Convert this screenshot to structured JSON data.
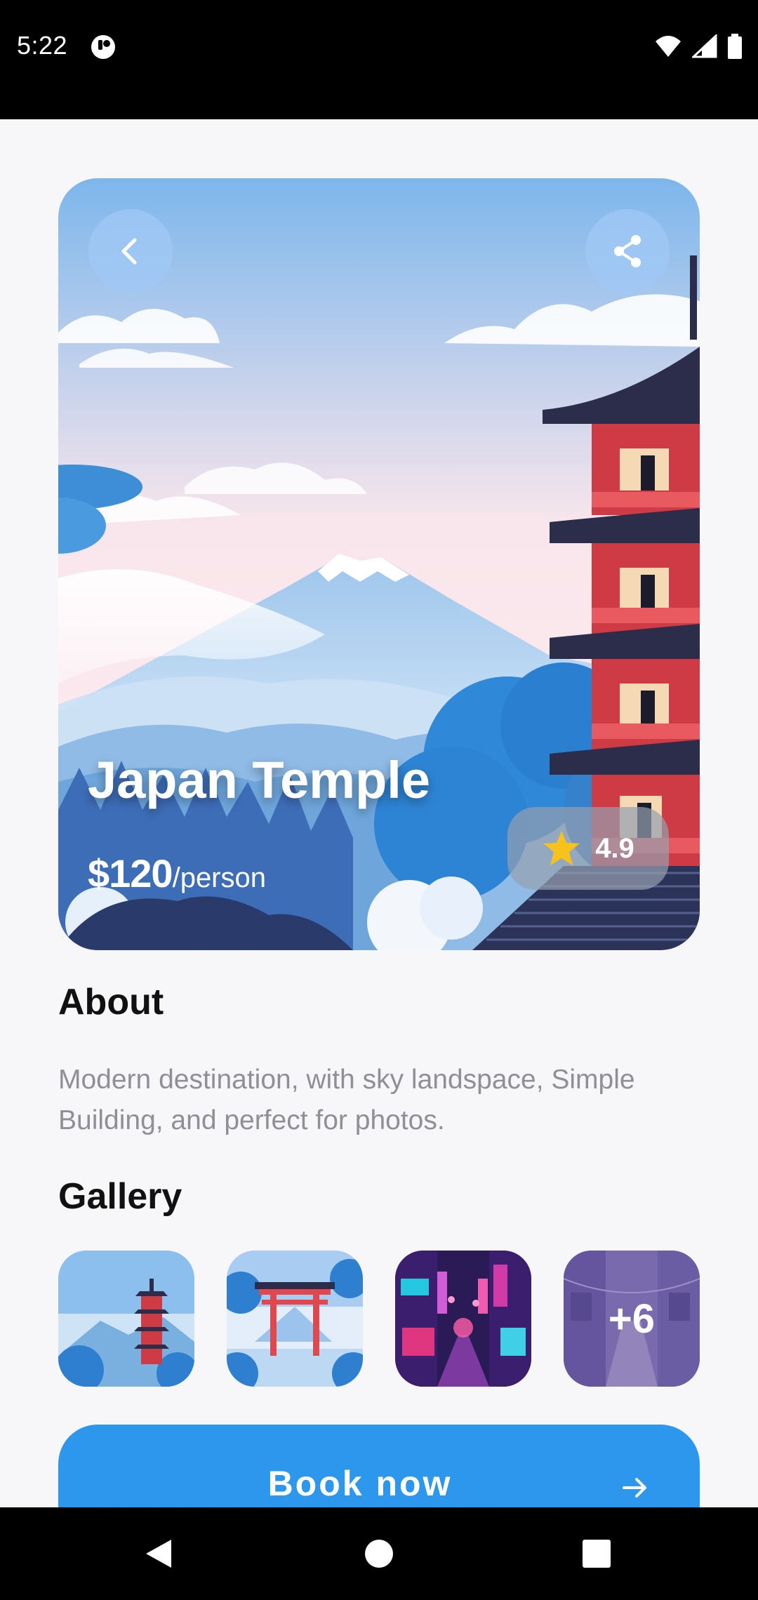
{
  "status_bar": {
    "time": "5:22"
  },
  "hero": {
    "title": "Japan Temple",
    "price": "$120",
    "price_unit": "/person",
    "rating": "4.9"
  },
  "about": {
    "title": "About",
    "text": "Modern destination, with sky landspace, Simple Building, and perfect for photos."
  },
  "gallery": {
    "title": "Gallery",
    "more_label": "+6"
  },
  "actions": {
    "book_label": "Book now"
  },
  "icons": {
    "back": "back-arrow-icon",
    "share": "share-icon",
    "star": "star-icon",
    "arrow": "arrow-right-icon"
  },
  "colors": {
    "accent": "#2d97ee",
    "star": "#f7c21b",
    "text_primary": "#111111",
    "text_secondary": "#8f8f96"
  }
}
